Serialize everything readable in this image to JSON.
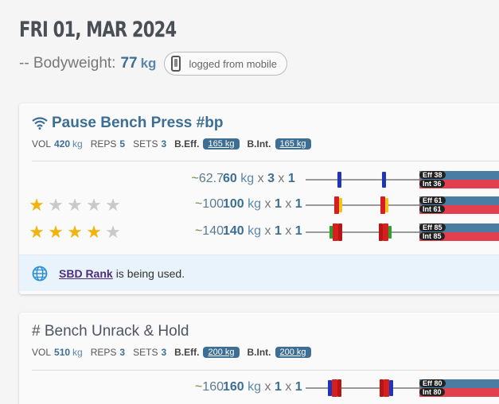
{
  "header": {
    "date": "FRI 01, MAR 2024",
    "bodyweight_label": "-- Bodyweight:",
    "bodyweight_value": "77",
    "bodyweight_unit": "kg",
    "mobile_label": "logged from mobile",
    "mobile_icon": "phone-icon"
  },
  "colors": {
    "accent": "#3d6e94",
    "star_on": "#f1b30e",
    "eff": "#4a7da1",
    "int": "#e2404f"
  },
  "exercises": [
    {
      "title": "Pause Bench Press #bp",
      "icon": "wifi-icon",
      "stats": {
        "vol_label": "VOL",
        "vol": "420",
        "vol_unit": "kg",
        "reps_label": "REPS",
        "reps": "5",
        "sets_label": "SETS",
        "sets": "3",
        "beff_label": "B.Eff.",
        "beff": "165 kg",
        "bint_label": "B.Int.",
        "bint": "165 kg"
      },
      "sets": [
        {
          "stars": 0,
          "e1rm_prefix": "~",
          "e1rm": "62.7",
          "weight": "60",
          "unit": "kg",
          "x1": "x",
          "reps": "3",
          "x2": "x",
          "sets": "1",
          "eff": "Eff 38",
          "int": "Int 36"
        },
        {
          "stars": 1,
          "e1rm_prefix": "~",
          "e1rm": "100",
          "weight": "100",
          "unit": "kg",
          "x1": "x",
          "reps": "1",
          "x2": "x",
          "sets": "1",
          "eff": "Eff 61",
          "int": "Int 61"
        },
        {
          "stars": 4,
          "e1rm_prefix": "~",
          "e1rm": "140",
          "weight": "140",
          "unit": "kg",
          "x1": "x",
          "reps": "1",
          "x2": "x",
          "sets": "1",
          "eff": "Eff 85",
          "int": "Int 85"
        }
      ],
      "info": {
        "link": "SBD Rank",
        "text": "is being used.",
        "icon": "globe-icon"
      }
    },
    {
      "title": "# Bench Unrack & Hold",
      "stats": {
        "vol_label": "VOL",
        "vol": "510",
        "vol_unit": "kg",
        "reps_label": "REPS",
        "reps": "3",
        "sets_label": "SETS",
        "sets": "3",
        "beff_label": "B.Eff.",
        "beff": "200 kg",
        "bint_label": "B.Int.",
        "bint": "200 kg"
      },
      "sets": [
        {
          "e1rm_prefix": "~",
          "e1rm": "160",
          "weight": "160",
          "unit": "kg",
          "x1": "x",
          "reps": "1",
          "x2": "x",
          "sets": "1",
          "eff": "Eff 80",
          "int": "Int 80"
        }
      ]
    }
  ]
}
